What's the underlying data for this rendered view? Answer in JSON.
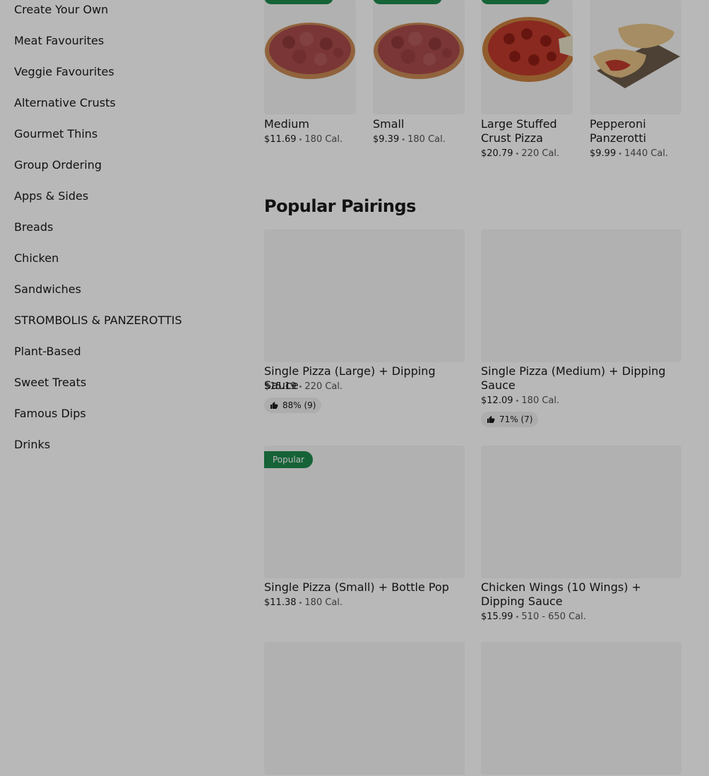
{
  "sidebar": {
    "categories": [
      "Create Your Own",
      "Meat Favourites",
      "Veggie Favourites",
      "Alternative Crusts",
      "Gourmet Thins",
      "Group Ordering",
      "Apps & Sides",
      "Breads",
      "Chicken",
      "Sandwiches",
      "STROMBOLIS & PANZEROTTIS",
      "Plant-Based",
      "Sweet Treats",
      "Famous Dips",
      "Drinks"
    ]
  },
  "items": [
    {
      "name": "Medium",
      "price": "$11.69",
      "cal": "180 Cal.",
      "image": "pizza-image"
    },
    {
      "name": "Small",
      "price": "$9.39",
      "cal": "180 Cal.",
      "image": "pizza-image"
    },
    {
      "name": "Large Stuffed Crust Pizza",
      "price": "$20.79",
      "cal": "220 Cal.",
      "image": "pepperoni-pizza-image"
    },
    {
      "name": "Pepperoni Panzerotti",
      "price": "$9.99",
      "cal": "1440 Cal.",
      "image": "panzerotti-image"
    }
  ],
  "popular_pairings": {
    "title": "Popular Pairings",
    "cards": [
      {
        "name": "Single Pizza (Large) + Dipping Sauce",
        "price": "$15.19",
        "cal": "220 Cal.",
        "rating": "88% (9)"
      },
      {
        "name": "Single Pizza (Medium) + Dipping Sauce",
        "price": "$12.09",
        "cal": "180 Cal.",
        "rating": "71% (7)"
      },
      {
        "name": "Single Pizza (Small) + Bottle Pop",
        "price": "$11.38",
        "cal": "180 Cal.",
        "badge": "Popular"
      },
      {
        "name": "Chicken Wings (10 Wings) + Dipping Sauce",
        "price": "$15.99",
        "cal": "510 - 650 Cal."
      },
      {
        "name": "",
        "price": "",
        "cal": ""
      },
      {
        "name": "",
        "price": "",
        "cal": ""
      }
    ]
  },
  "icons": {
    "rating": "thumbs-up-icon"
  },
  "colors": {
    "accent": "#1f8a4e",
    "overlay": "rgba(0,0,0,0.28)"
  }
}
